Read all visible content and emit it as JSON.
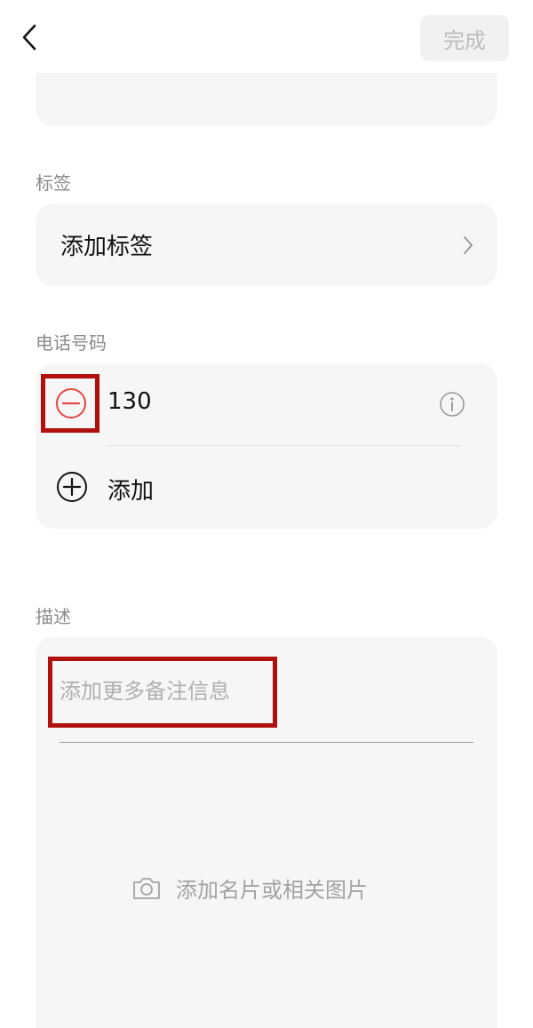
{
  "header": {
    "back_icon": "chevron-left-icon",
    "done_label": "完成"
  },
  "tags": {
    "section_label": "标签",
    "add_label": "添加标签",
    "chevron_icon": "chevron-right-icon"
  },
  "phone": {
    "section_label": "电话号码",
    "numbers": [
      {
        "value": "130"
      }
    ],
    "remove_icon": "minus-circle-icon",
    "info_icon": "info-icon",
    "add_label": "添加",
    "add_icon": "plus-circle-icon"
  },
  "description": {
    "section_label": "描述",
    "note_placeholder": "添加更多备注信息",
    "note_value": "",
    "photo_label": "添加名片或相关图片",
    "photo_icon": "camera-icon"
  },
  "colors": {
    "card_bg": "#f6f6f6",
    "highlight_red": "#b0100e",
    "remove_red": "#e64545",
    "label_gray": "#8a8a8a",
    "placeholder_gray": "#b0b0b0",
    "done_bg": "#f1f1f1",
    "done_text": "#bdbdbd"
  }
}
